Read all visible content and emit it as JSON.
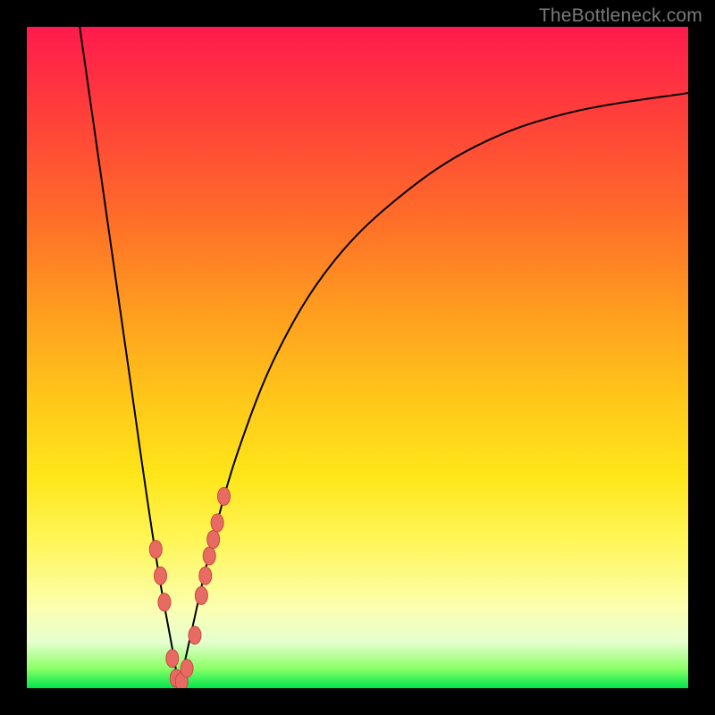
{
  "watermark": {
    "text": "TheBottleneck.com"
  },
  "colors": {
    "curve_stroke": "#000000",
    "marker_fill": "#e76b63",
    "marker_stroke": "#c74a42",
    "frame_bg": "#000000"
  },
  "chart_data": {
    "type": "line",
    "title": "",
    "xlabel": "",
    "ylabel": "",
    "xlim": [
      0,
      100
    ],
    "ylim": [
      0,
      100
    ],
    "grid": false,
    "legend": false,
    "series": [
      {
        "name": "left-branch",
        "x": [
          8,
          10,
          12,
          14,
          16,
          18,
          20,
          22,
          23
        ],
        "y": [
          100,
          86,
          72,
          58,
          44,
          30,
          17,
          6,
          0
        ]
      },
      {
        "name": "right-branch",
        "x": [
          23,
          25,
          28,
          32,
          38,
          46,
          56,
          68,
          82,
          100
        ],
        "y": [
          0,
          9,
          22,
          36,
          51,
          64,
          74,
          82,
          87,
          90
        ]
      }
    ],
    "markers": {
      "name": "highlighted-points",
      "x": [
        19.5,
        20.2,
        20.8,
        22.0,
        22.6,
        23.4,
        24.2,
        25.4,
        26.4,
        27.0,
        27.6,
        28.2,
        28.8,
        29.8
      ],
      "y": [
        21.0,
        17.0,
        13.0,
        4.5,
        1.5,
        1.0,
        3.0,
        8.0,
        14.0,
        17.0,
        20.0,
        22.5,
        25.0,
        29.0
      ]
    }
  }
}
